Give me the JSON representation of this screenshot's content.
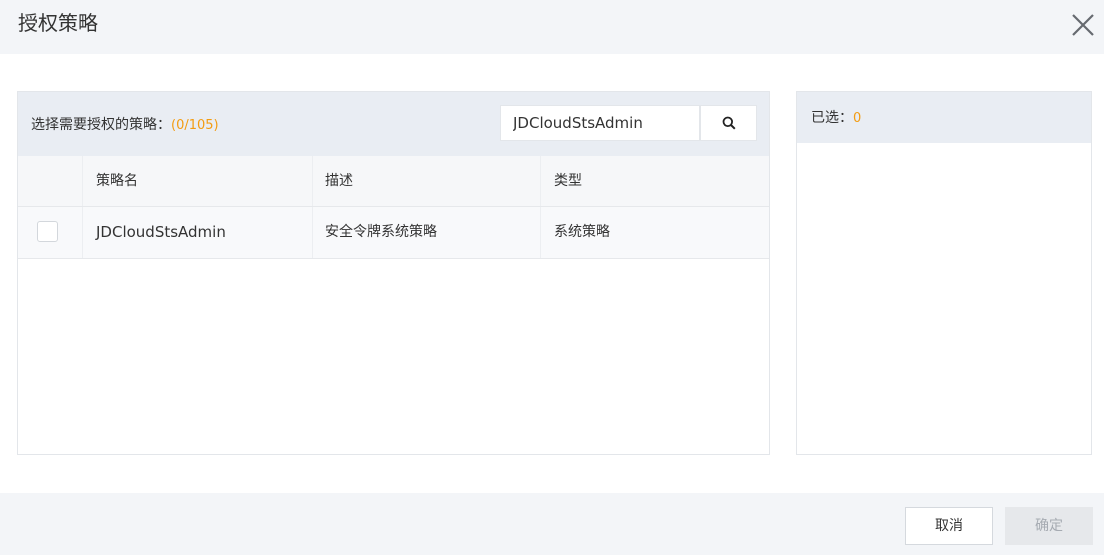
{
  "dialog": {
    "title": "授权策略"
  },
  "left_panel": {
    "select_label": "选择需要授权的策略：",
    "count": "(0/105)",
    "search": {
      "value": "JDCloudStsAdmin"
    },
    "table": {
      "columns": [
        "策略名",
        "描述",
        "类型"
      ],
      "rows": [
        {
          "name": "JDCloudStsAdmin",
          "description": "安全令牌系统策略",
          "type": "系统策略",
          "checked": false
        }
      ]
    }
  },
  "right_panel": {
    "selected_label": "已选：",
    "selected_count": "0"
  },
  "footer": {
    "cancel_label": "取消",
    "confirm_label": "确定"
  },
  "colors": {
    "accent_count": "#f39c12",
    "header_bg": "#f3f5f8",
    "panel_head_bg": "#e9edf3",
    "disabled_button_bg": "#e6e8eb"
  },
  "icons": {
    "close": "close-icon",
    "search": "search-icon"
  }
}
